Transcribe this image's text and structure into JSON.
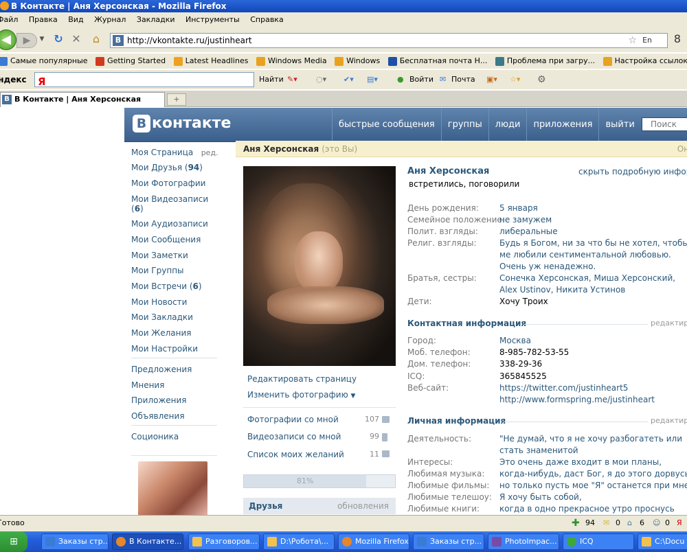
{
  "window": {
    "title": "В Контакте | Аня Херсонская - Mozilla Firefox"
  },
  "menu": [
    "Файл",
    "Правка",
    "Вид",
    "Журнал",
    "Закладки",
    "Инструменты",
    "Справка"
  ],
  "navbar": {
    "url": "http://vkontakte.ru/justinheart",
    "lang": "En"
  },
  "bookmarks": [
    {
      "label": "Самые популярные",
      "color": "#3a7bd5"
    },
    {
      "label": "Getting Started",
      "color": "#d23a1f"
    },
    {
      "label": "Latest Headlines",
      "color": "#f0a020"
    },
    {
      "label": "Windows Media",
      "color": "#e9a21f"
    },
    {
      "label": "Windows",
      "color": "#e9a21f"
    },
    {
      "label": "Бесплатная почта Н...",
      "color": "#1f4fa8"
    },
    {
      "label": "Проблема при загру...",
      "color": "#3a7a8a"
    },
    {
      "label": "Настройка ссылок",
      "color": "#e9a21f"
    }
  ],
  "yandexbar": {
    "brand": "Яндекс",
    "logo": "Я",
    "find": "Найти",
    "login": "Войти",
    "mail": "Почта"
  },
  "tabs": {
    "active": "В Контакте | Аня Херсонская",
    "new_tab": "+"
  },
  "vk": {
    "logo": "контакте",
    "logo_letter": "B",
    "nav": [
      "быстрые сообщения",
      "группы",
      "люди",
      "приложения",
      "выйти"
    ],
    "search_placeholder": "Поиск",
    "left_menu": [
      {
        "label": "Моя Страница",
        "extra": "ред."
      },
      {
        "label": "Мои Друзья",
        "count": "94"
      },
      {
        "label": "Мои Фотографии"
      },
      {
        "label": "Мои Видеозаписи",
        "count": "6"
      },
      {
        "label": "Мои Аудиозаписи"
      },
      {
        "label": "Мои Сообщения"
      },
      {
        "label": "Мои Заметки"
      },
      {
        "label": "Мои Группы"
      },
      {
        "label": "Мои Встречи",
        "count": "6"
      },
      {
        "label": "Мои Новости"
      },
      {
        "label": "Мои Закладки"
      },
      {
        "label": "Мои Желания"
      },
      {
        "label": "Мои Настройки"
      },
      {
        "label": "Предложения"
      },
      {
        "label": "Мнения"
      },
      {
        "label": "Приложения"
      },
      {
        "label": "Объявления"
      },
      {
        "label": "Соционика"
      }
    ],
    "profile_header": {
      "name": "Аня Херсонская",
      "you": "(это Вы)",
      "online": "Он"
    },
    "photo_actions": {
      "edit": "Редактировать страницу",
      "change_photo": "Изменить фотографию"
    },
    "photo_links": [
      {
        "label": "Фотографии со мной",
        "count": "107"
      },
      {
        "label": "Видеозаписи со мной",
        "count": "99"
      },
      {
        "label": "Список моих желаний",
        "count": "11"
      }
    ],
    "completion": {
      "value": 0.81,
      "label": "81%"
    },
    "friends_block": {
      "title": "Друзья",
      "updates": "обновления"
    },
    "info": {
      "name": "Аня Херсонская",
      "status": "встретились, поговорили",
      "hide_link": "скрыть подробную информ",
      "basic": [
        {
          "label": "День рождения:",
          "value": "5 января"
        },
        {
          "label": "Семейное положение:",
          "value": "не замужем"
        },
        {
          "label": "Полит. взгляды:",
          "value": "либеральные"
        },
        {
          "label": "Религ. взгляды:",
          "value": "Будь я Богом, ни за что бы не хотел, чтобы ме любили сентиментальной любовью. Очень уж ненадежно."
        },
        {
          "label": "Братья, сестры:",
          "value": "Сонечка Херсонская, Миша Херсонский, Alex Ustinov, Никита Устинов"
        },
        {
          "label": "Дети:",
          "value": "Хочу Троих"
        }
      ],
      "contact_title": "Контактная информация",
      "contact_edit": "редактиро",
      "contact": [
        {
          "label": "Город:",
          "value": "Москва"
        },
        {
          "label": "Моб. телефон:",
          "value": "8-985-782-53-55"
        },
        {
          "label": "Дом. телефон:",
          "value": "338-29-36"
        },
        {
          "label": "ICQ:",
          "value": "365845525"
        },
        {
          "label": "Веб-сайт:",
          "value": "https://twitter.com/justinheart5"
        },
        {
          "label": "",
          "value": "http://www.formspring.me/justinheart"
        }
      ],
      "personal_title": "Личная информация",
      "personal_edit": "редактиро",
      "personal": [
        {
          "label": "Деятельность:",
          "value": "\"Не думай, что я не хочу разбогатеть или стать знаменитой"
        },
        {
          "label": "Интересы:",
          "value": "Это очень даже входит в мои планы,"
        },
        {
          "label": "Любимая музыка:",
          "value": "когда-нибудь, даст Бог, я до этого дорвусь,"
        },
        {
          "label": "Любимые фильмы:",
          "value": "но только пусть мое \"Я\" останется при мне"
        },
        {
          "label": "Любимые телешоу:",
          "value": "Я хочу быть собой,"
        },
        {
          "label": "Любимые книги:",
          "value": "когда в одно прекрасное утро проснусь"
        }
      ]
    }
  },
  "statusbar": {
    "text": "Готово",
    "add_count": "94",
    "notes_count": "0",
    "home_count": "6",
    "people_count": "0"
  },
  "taskbar": [
    {
      "label": "Заказы стр..."
    },
    {
      "label": "В Контакте..."
    },
    {
      "label": "Разговоров..."
    },
    {
      "label": "D:\\Робота\\..."
    },
    {
      "label": "Mozilla Firefox"
    },
    {
      "label": "Заказы стр..."
    },
    {
      "label": "PhotoImpac..."
    },
    {
      "label": "ICQ"
    },
    {
      "label": "C:\\Docu"
    }
  ]
}
